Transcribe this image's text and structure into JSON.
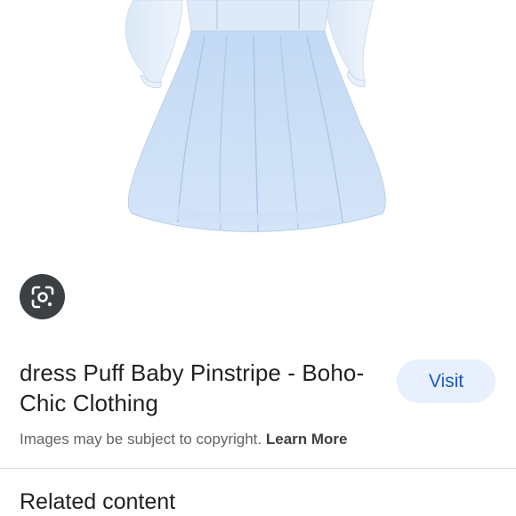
{
  "image": {
    "icon": "dress-product-image"
  },
  "lens": {
    "icon": "lens-icon"
  },
  "result": {
    "title": "dress Puff Baby Pinstripe - Boho-Chic Clothing",
    "visit_label": "Visit"
  },
  "notice": {
    "text": "Images may be subject to copyright.",
    "link_label": "Learn More"
  },
  "related": {
    "heading": "Related content"
  },
  "colors": {
    "dress": "#b9d3f2",
    "lens_button_bg": "#3c4043",
    "visit_bg": "#e8f0fe",
    "visit_text": "#1a56c4"
  }
}
